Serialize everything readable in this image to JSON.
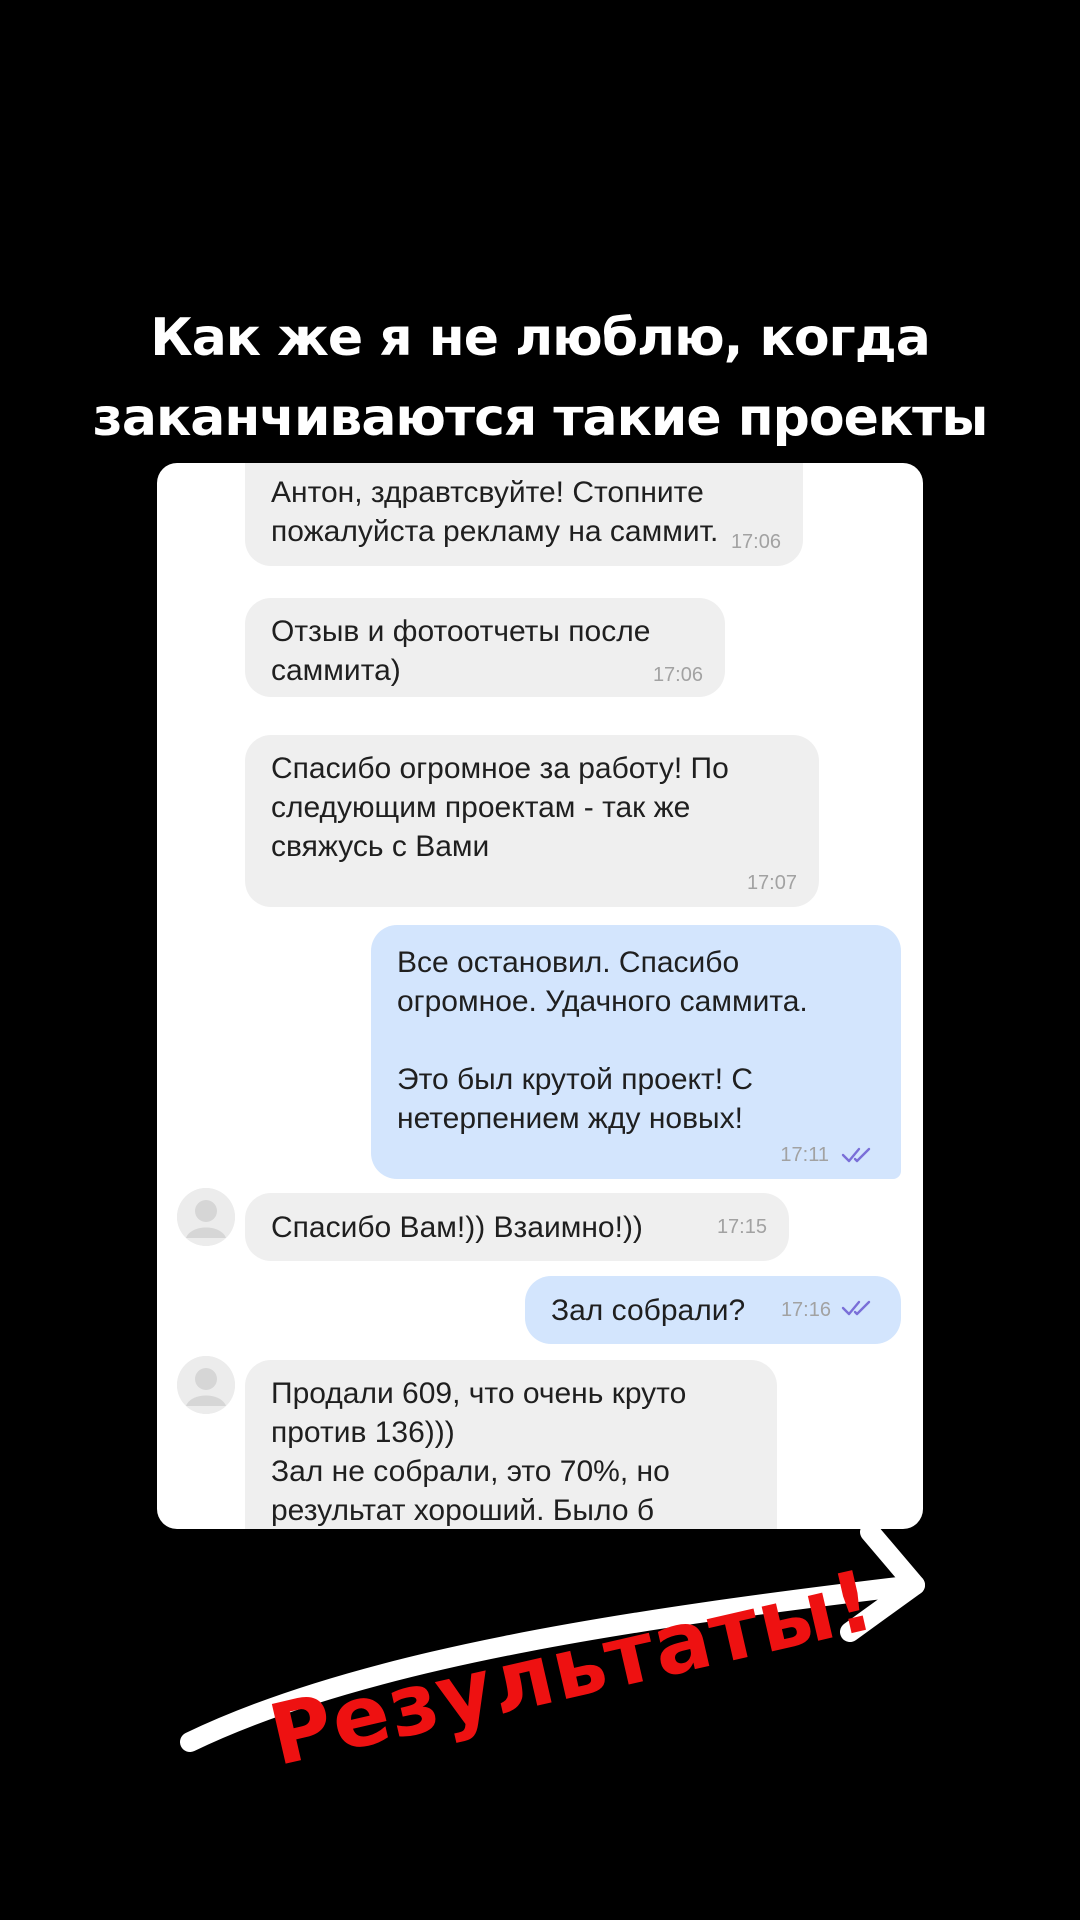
{
  "headline": {
    "line1": "Как же я не люблю, когда",
    "line2": "заканчиваются такие проекты"
  },
  "chat": {
    "messages": [
      {
        "direction": "in",
        "text": "Антон, здравтсвуйте! Стопните\nпожалуйста рекламу на саммит.",
        "time": "17:06"
      },
      {
        "direction": "in",
        "text": "Отзыв и фотоотчеты после\nсаммита)",
        "time": "17:06"
      },
      {
        "direction": "in",
        "text": "Спасибо огромное за работу! По\nследующим проектам - так же\nсвяжусь с Вами",
        "time": "17:07"
      },
      {
        "direction": "out",
        "text": "Все остановил. Спасибо\nогромное. Удачного саммита.\n\nЭто был крутой проект! С\nнетерпением жду новых!",
        "time": "17:11",
        "read": true
      },
      {
        "direction": "in",
        "text": "Спасибо Вам!)) Взаимно!))",
        "time": "17:15",
        "avatar": true
      },
      {
        "direction": "out",
        "text": "Зал собрали?",
        "time": "17:16",
        "read": true
      },
      {
        "direction": "in",
        "text": "Продали 609, что очень круто\nпротив 136)))\nЗал не собрали, это 70%, но\nрезультат хороший. Было б",
        "avatar": true
      }
    ]
  },
  "overlay": {
    "results_label": "Результаты!",
    "arrow_icon": "curved-arrow-icon",
    "results_color": "#ee1111"
  },
  "colors": {
    "background": "#000000",
    "incoming_bubble": "#efefef",
    "outgoing_bubble": "#d3e5fd",
    "read_ticks": "#7a6fd8"
  }
}
